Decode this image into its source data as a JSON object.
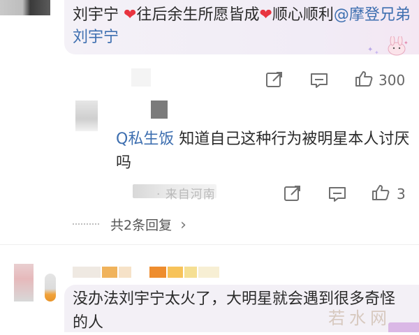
{
  "comment1": {
    "text_a": "刘宇宁 ",
    "heart1": "❤",
    "text_b": "往后余生所愿皆成",
    "heart2": "❤",
    "text_c": "顺心顺利",
    "mention": "@摩登兄弟刘宇宁",
    "like_count": "300"
  },
  "reply": {
    "topic": "Q私生饭",
    "text": " 知道自己这种行为被明星本人讨厌吗",
    "meta": "· 来自河南",
    "like_count": "3",
    "more_label": "共2条回复",
    "more_chevron": "›"
  },
  "comment2": {
    "text": "没办法刘宇宁太火了，大明星就会遇到很多奇怪的人"
  },
  "watermark": {
    "text": "若水网"
  },
  "colors": {
    "mention_blue": "#3e6fb0",
    "heart_red": "#e8343f",
    "bubble_bg": "#f3f0f6"
  },
  "icons": {
    "share": "share-icon",
    "comment": "comment-icon",
    "like": "thumbs-up-icon",
    "chevron": "chevron-right-icon"
  }
}
